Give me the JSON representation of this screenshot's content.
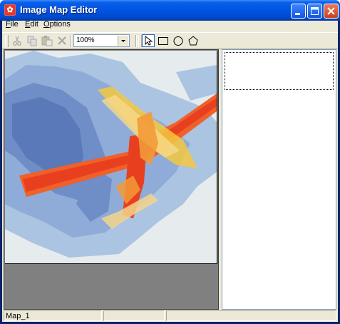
{
  "window": {
    "title": "Image Map Editor",
    "app_icon_glyph": "✿"
  },
  "menu": {
    "items": [
      {
        "label": "File",
        "underline": "F",
        "rest": "ile"
      },
      {
        "label": "Edit",
        "underline": "E",
        "rest": "dit"
      },
      {
        "label": "Options",
        "underline": "O",
        "rest": "ptions"
      }
    ]
  },
  "toolbar": {
    "cut_icon": "scissors-icon",
    "copy_icon": "copy-icon",
    "paste_icon": "paste-icon",
    "delete_icon": "delete-icon",
    "zoom_value": "100%",
    "tools": [
      "pointer-icon",
      "rectangle-icon",
      "circle-icon",
      "polygon-icon"
    ]
  },
  "image": {
    "description": ""
  },
  "list": {
    "items": [
      ""
    ]
  },
  "status": {
    "map_name": "Map_1",
    "cell2": "",
    "cell3": ""
  },
  "colors": {
    "title_blue": "#0054e3",
    "close_red": "#c8401f",
    "chrome": "#ece9d8"
  }
}
